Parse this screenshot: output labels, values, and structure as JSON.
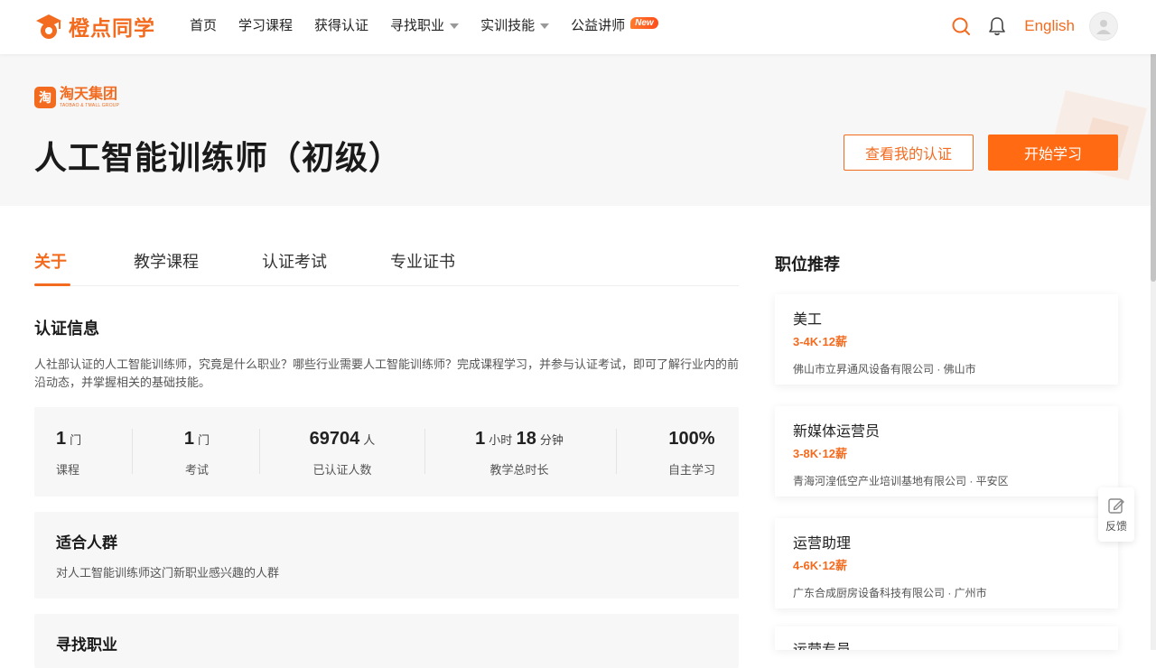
{
  "brand": {
    "name": "橙点同学"
  },
  "nav": {
    "items": [
      {
        "label": "首页",
        "dropdown": false
      },
      {
        "label": "学习课程",
        "dropdown": false
      },
      {
        "label": "获得认证",
        "dropdown": false
      },
      {
        "label": "寻找职业",
        "dropdown": true
      },
      {
        "label": "实训技能",
        "dropdown": true
      },
      {
        "label": "公益讲师",
        "dropdown": false,
        "badge": "New"
      }
    ],
    "language": "English"
  },
  "hero": {
    "org_name": "淘天集团",
    "org_sub": "TAOBAO & TMALL GROUP",
    "org_icon": "淘",
    "title": "人工智能训练师（初级）",
    "view_cert_button": "查看我的认证",
    "start_button": "开始学习"
  },
  "tabs": [
    {
      "label": "关于",
      "active": true
    },
    {
      "label": "教学课程",
      "active": false
    },
    {
      "label": "认证考试",
      "active": false
    },
    {
      "label": "专业证书",
      "active": false
    }
  ],
  "about": {
    "section_title": "认证信息",
    "description": "人社部认证的人工智能训练师，究竟是什么职业？哪些行业需要人工智能训练师？完成课程学习，并参与认证考试，即可了解行业内的前沿动态，并掌握相关的基础技能。",
    "stats": [
      {
        "value": "1",
        "unit": "门",
        "label": "课程"
      },
      {
        "value": "1",
        "unit": "门",
        "label": "考试"
      },
      {
        "value": "69704",
        "unit": "人",
        "label": "已认证人数"
      },
      {
        "value": "1",
        "unit": "小时",
        "value2": "18",
        "unit2": "分钟",
        "label": "教学总时长"
      },
      {
        "value": "100%",
        "unit": "",
        "label": "自主学习"
      }
    ],
    "audience": {
      "title": "适合人群",
      "text": "对人工智能训练师这门新职业感兴趣的人群"
    },
    "career": {
      "title": "寻找职业"
    }
  },
  "jobs": {
    "title": "职位推荐",
    "items": [
      {
        "name": "美工",
        "salary": "3-4K·12薪",
        "company": "佛山市立昇通风设备有限公司 · 佛山市"
      },
      {
        "name": "新媒体运营员",
        "salary": "3-8K·12薪",
        "company": "青海河湟低空产业培训基地有限公司 · 平安区"
      },
      {
        "name": "运营助理",
        "salary": "4-6K·12薪",
        "company": "广东合成厨房设备科技有限公司 · 广州市"
      },
      {
        "name": "运营专员",
        "salary": "",
        "company": ""
      }
    ]
  },
  "feedback": {
    "label": "反馈"
  },
  "colors": {
    "accent": "#f26b1f",
    "primary_button": "#ff6a13",
    "panel": "#f7f7f7"
  }
}
